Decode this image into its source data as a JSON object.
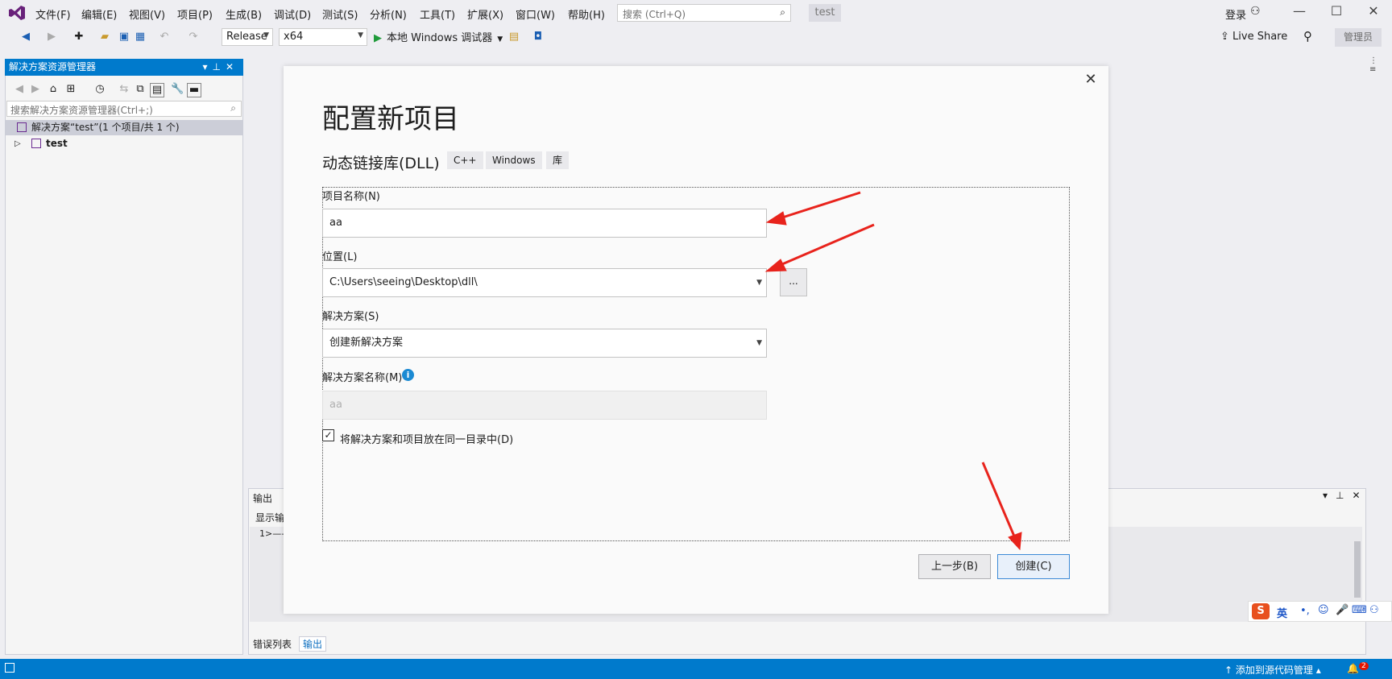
{
  "menubar": {
    "items": [
      "文件(F)",
      "编辑(E)",
      "视图(V)",
      "项目(P)",
      "生成(B)",
      "调试(D)",
      "测试(S)",
      "分析(N)",
      "工具(T)",
      "扩展(X)",
      "窗口(W)",
      "帮助(H)"
    ],
    "search_placeholder": "搜索 (Ctrl+Q)",
    "solution_badge": "test",
    "login_label": "登录",
    "window_controls": [
      "—",
      "☐",
      "✕"
    ]
  },
  "toolbar": {
    "config": "Release",
    "platform": "x64",
    "run_label": "本地 Windows 调试器",
    "live_share": "Live Share",
    "admin_label": "管理员"
  },
  "solution_explorer": {
    "title": "解决方案资源管理器",
    "search_placeholder": "搜索解决方案资源管理器(Ctrl+;)",
    "solution_row": "解决方案“test”(1 个项目/共 1 个)",
    "project_row": "test"
  },
  "output_panel": {
    "title": "输出",
    "show_label": "显示输",
    "text": "1>——",
    "tabs": [
      "错误列表",
      "输出"
    ]
  },
  "dialog": {
    "title": "配置新项目",
    "subtitle": "动态链接库(DLL)",
    "tags": [
      "C++",
      "Windows",
      "库"
    ],
    "project_name_label": "项目名称(N)",
    "project_name_value": "aa",
    "location_label": "位置(L)",
    "location_value": "C:\\Users\\seeing\\Desktop\\dll\\",
    "browse_label": "...",
    "solution_label": "解决方案(S)",
    "solution_value": "创建新解决方案",
    "solution_name_label": "解决方案名称(M)",
    "solution_name_value": "aa",
    "same_dir_label": "将解决方案和项目放在同一目录中(D)",
    "same_dir_checked": true,
    "back_button": "上一步(B)",
    "create_button": "创建(C)"
  },
  "ime_bar": {
    "mode": "英"
  },
  "statusbar": {
    "source_control": "添加到源代码管理",
    "notifications": "2"
  },
  "colors": {
    "accent": "#007acc",
    "annotation_arrow": "#e8231c"
  }
}
